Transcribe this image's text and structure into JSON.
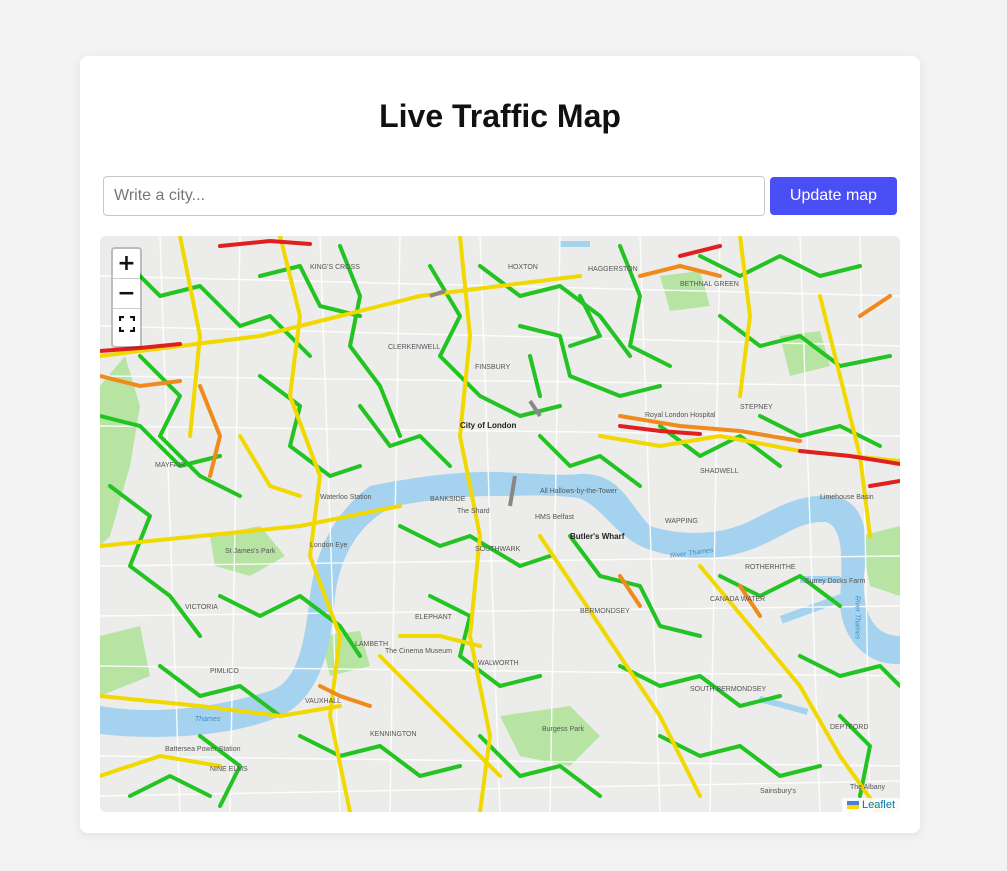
{
  "header": {
    "title": "Live Traffic Map"
  },
  "search": {
    "placeholder": "Write a city...",
    "value": ""
  },
  "update_button": {
    "label": "Update map"
  },
  "zoom": {
    "in_label": "+",
    "out_label": "−"
  },
  "attribution": {
    "label": "Leaflet"
  },
  "map_labels": {
    "city_of_london": "City of London",
    "butlers_wharf": "Butler's Wharf",
    "river_thames_1": "River Thames",
    "river_thames_2": "River Thames",
    "river_thames_3": "Thames",
    "bermondsey": "BERMONDSEY",
    "southwark": "SOUTHWARK",
    "lambeth": "LAMBETH",
    "kennington": "KENNINGTON",
    "walworth": "WALWORTH",
    "rotherhithe": "ROTHERHITHE",
    "wapping": "WAPPING",
    "shadwell": "SHADWELL",
    "stepney": "STEPNEY",
    "hoxton": "HOXTON",
    "haggerston": "HAGGERSTON",
    "clerkenwell": "CLERKENWELL",
    "finsbury": "FINSBURY",
    "mayfair": "MAYFAIR",
    "pimlico": "PIMLICO",
    "victoria": "VICTORIA",
    "nine_elms": "NINE ELMS",
    "burgess_park": "Burgess Park",
    "the_cinema_museum": "The Cinema Museum",
    "the_shard": "The Shard",
    "hms_belfast": "HMS Belfast",
    "all_hallows": "All Hallows-by-the-Tower",
    "south_bermondsey": "SOUTH BERMONDSEY",
    "surrey_docks_farm": "Surrey Docks Farm",
    "battersea_power_station": "Battersea Power Station",
    "vauxhall": "VAUXHALL",
    "elephant": "ELEPHANT",
    "st_james_park": "St James's Park",
    "waterloo": "Waterloo Station",
    "bankside": "BANKSIDE",
    "whitechapel": "Royal London Hospital",
    "bethnal_green": "BETHNAL GREEN",
    "london_eye": "London Eye",
    "kings_cross": "KING'S CROSS",
    "the_albany": "The Albany",
    "sainsburys": "Sainsbury's",
    "deptford": "DEPTFORD",
    "canada_water": "CANADA WATER",
    "st_george": "Limehouse Basin"
  },
  "colors": {
    "traffic_green": "#22c322",
    "traffic_yellow": "#f0d800",
    "traffic_orange": "#f08a1c",
    "traffic_red": "#e02020",
    "water": "#a5d3ef",
    "park": "#b7e4a3",
    "button": "#4a4ef5"
  },
  "icons": {
    "zoom_in": "plus-icon",
    "zoom_out": "minus-icon",
    "fullscreen": "fullscreen-icon",
    "flag": "ukraine-flag-icon"
  }
}
